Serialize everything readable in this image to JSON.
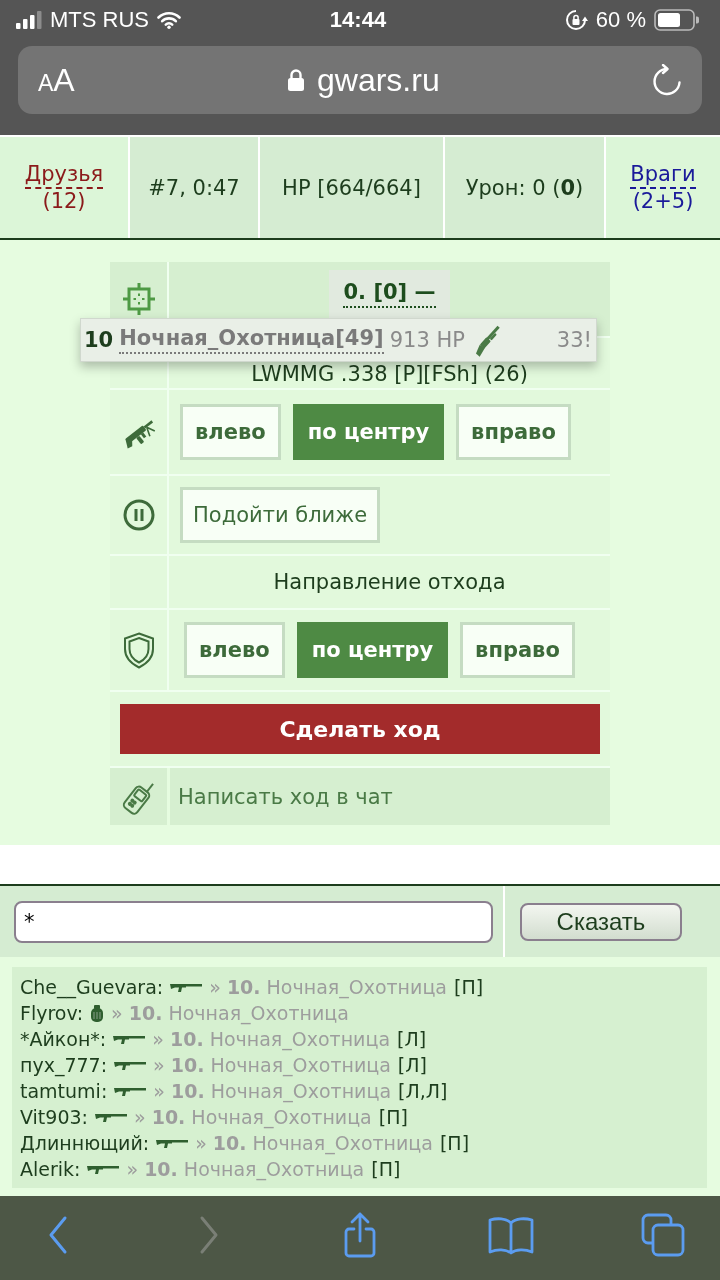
{
  "status_bar": {
    "carrier": "MTS RUS",
    "time": "14:44",
    "battery": "60 %"
  },
  "browser": {
    "text_size": "AA",
    "url": "gwars.ru"
  },
  "header": {
    "friends": {
      "label": "Друзья",
      "count": "(12)"
    },
    "round": "#7, 0:47",
    "hp": "HP [664/664]",
    "damage": "Урон: 0 (**0**)",
    "enemies": {
      "label": "Враги",
      "count": "(2+5)"
    }
  },
  "battle": {
    "target": "0. [0] —",
    "tooltip": {
      "number": "10",
      "name": "Ночная_Охотница[49]",
      "hp": "913 HP",
      "suffix": "33!"
    },
    "weapon": "LWMMG .338 [P][FSh] (26)",
    "attack": [
      {
        "label": "влево",
        "selected": false
      },
      {
        "label": "по центру",
        "selected": true
      },
      {
        "label": "вправо",
        "selected": false
      }
    ],
    "approach": "Подойти ближе",
    "retreat_title": "Направление отхода",
    "retreat": [
      {
        "label": "влево",
        "selected": false
      },
      {
        "label": "по центру",
        "selected": true
      },
      {
        "label": "вправо",
        "selected": false
      }
    ],
    "submit": "Сделать ход",
    "chat_move": "Написать ход в чат"
  },
  "chat": {
    "input_value": "*",
    "send": "Сказать",
    "log": [
      {
        "sender": "Che__Guevara:",
        "kind": "gun",
        "target": "» **10.** Ночная_Охотница",
        "sides": "[П]"
      },
      {
        "sender": "Flyrov:",
        "kind": "grenade",
        "target": "» **10.** Ночная_Охотница"
      },
      {
        "sender": "*Айкон*:",
        "kind": "gun",
        "target": "» **10.** Ночная_Охотница",
        "sides": "[Л]"
      },
      {
        "sender": "пух_777:",
        "kind": "gun",
        "target": "» **10.** Ночная_Охотница",
        "sides": "[Л]"
      },
      {
        "sender": "tamtumi:",
        "kind": "gun",
        "target": "» **10.** Ночная_Охотница",
        "sides": "[Л,Л]"
      },
      {
        "sender": "Vit903:",
        "kind": "gun",
        "target": "» **10.** Ночная_Охотница",
        "sides": "[П]"
      },
      {
        "sender": "Длиннющий:",
        "kind": "gun",
        "target": "» **10.** Ночная_Охотница",
        "sides": "[П]"
      },
      {
        "sender": "Alerik:",
        "kind": "gun",
        "target": "» **10.** Ночная_Охотница",
        "sides": "[П]"
      }
    ]
  },
  "toolbar": {
    "buttons": [
      {
        "kind": "back",
        "disabled": false
      },
      {
        "kind": "forward",
        "disabled": true
      },
      {
        "kind": "share",
        "disabled": false
      },
      {
        "kind": "bookmarks",
        "disabled": false
      },
      {
        "kind": "tabs",
        "disabled": false
      }
    ]
  }
}
